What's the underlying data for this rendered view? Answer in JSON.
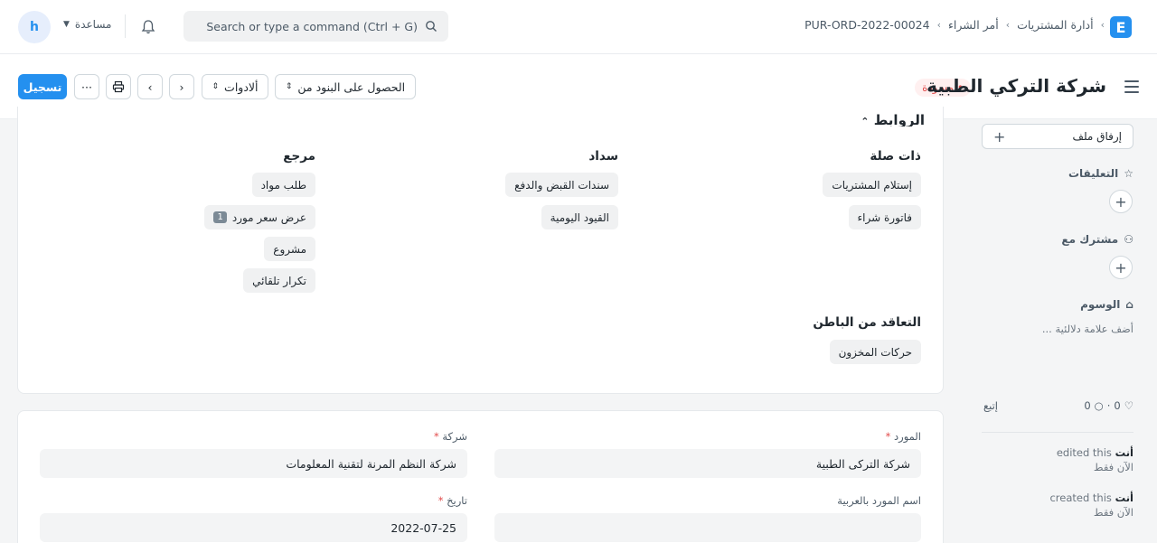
{
  "navbar": {
    "avatar_letter": "h",
    "help_label": "مساعدة",
    "search_placeholder": "Search or type a command (Ctrl + G)",
    "breadcrumb": [
      "أدارة المشتريات",
      "أمر الشراء",
      "PUR-ORD-2022-00024"
    ],
    "logo_letter": "E"
  },
  "header": {
    "title": "شركة التركي الطبية",
    "status": "مسودة",
    "submit_label": "تسجيل",
    "more_label": "···",
    "tools_label": "ألادوات",
    "get_items_label": "الحصول على البنود من"
  },
  "links": {
    "section_title": "الروابط",
    "columns": [
      {
        "heading": "ذات صلة",
        "items": [
          "إستلام المشتريات",
          "فاتورة شراء"
        ]
      },
      {
        "heading": "سداد",
        "items": [
          "سندات القبض والدفع",
          "القيود اليومية"
        ]
      },
      {
        "heading": "مرجع",
        "items": [
          "طلب مواد",
          "عرض سعر مورد",
          "مشروع",
          "تكرار تلقائي"
        ],
        "counts": {
          "1": "1"
        }
      }
    ],
    "subcontract": {
      "heading": "التعاقد من الباطن",
      "items": [
        "حركات المخزون"
      ]
    }
  },
  "form": {
    "supplier_label": "المورد",
    "supplier_value": "شركة التركى الطبية",
    "company_label": "شركة",
    "company_value": "شركة النظم المرنة لتقنية المعلومات",
    "supplier_ar_label": "اسم المورد بالعربية",
    "supplier_ar_value": "",
    "date_label": "تاريخ",
    "date_value": "2022-07-25"
  },
  "sidebar": {
    "attach_label": "إرفاق ملف",
    "comments_label": "التعليقات",
    "shared_label": "مشترك مع",
    "tags_label": "الوسوم",
    "tag_placeholder": "أضف علامة دلالئية ...",
    "follow_label": "إتبع",
    "likes_count": "0",
    "comments_count": "0",
    "activity": [
      {
        "user": "أنت",
        "action": "edited this",
        "time": "الآن فقط"
      },
      {
        "user": "أنت",
        "action": "created this",
        "time": "الآن فقط"
      }
    ]
  }
}
